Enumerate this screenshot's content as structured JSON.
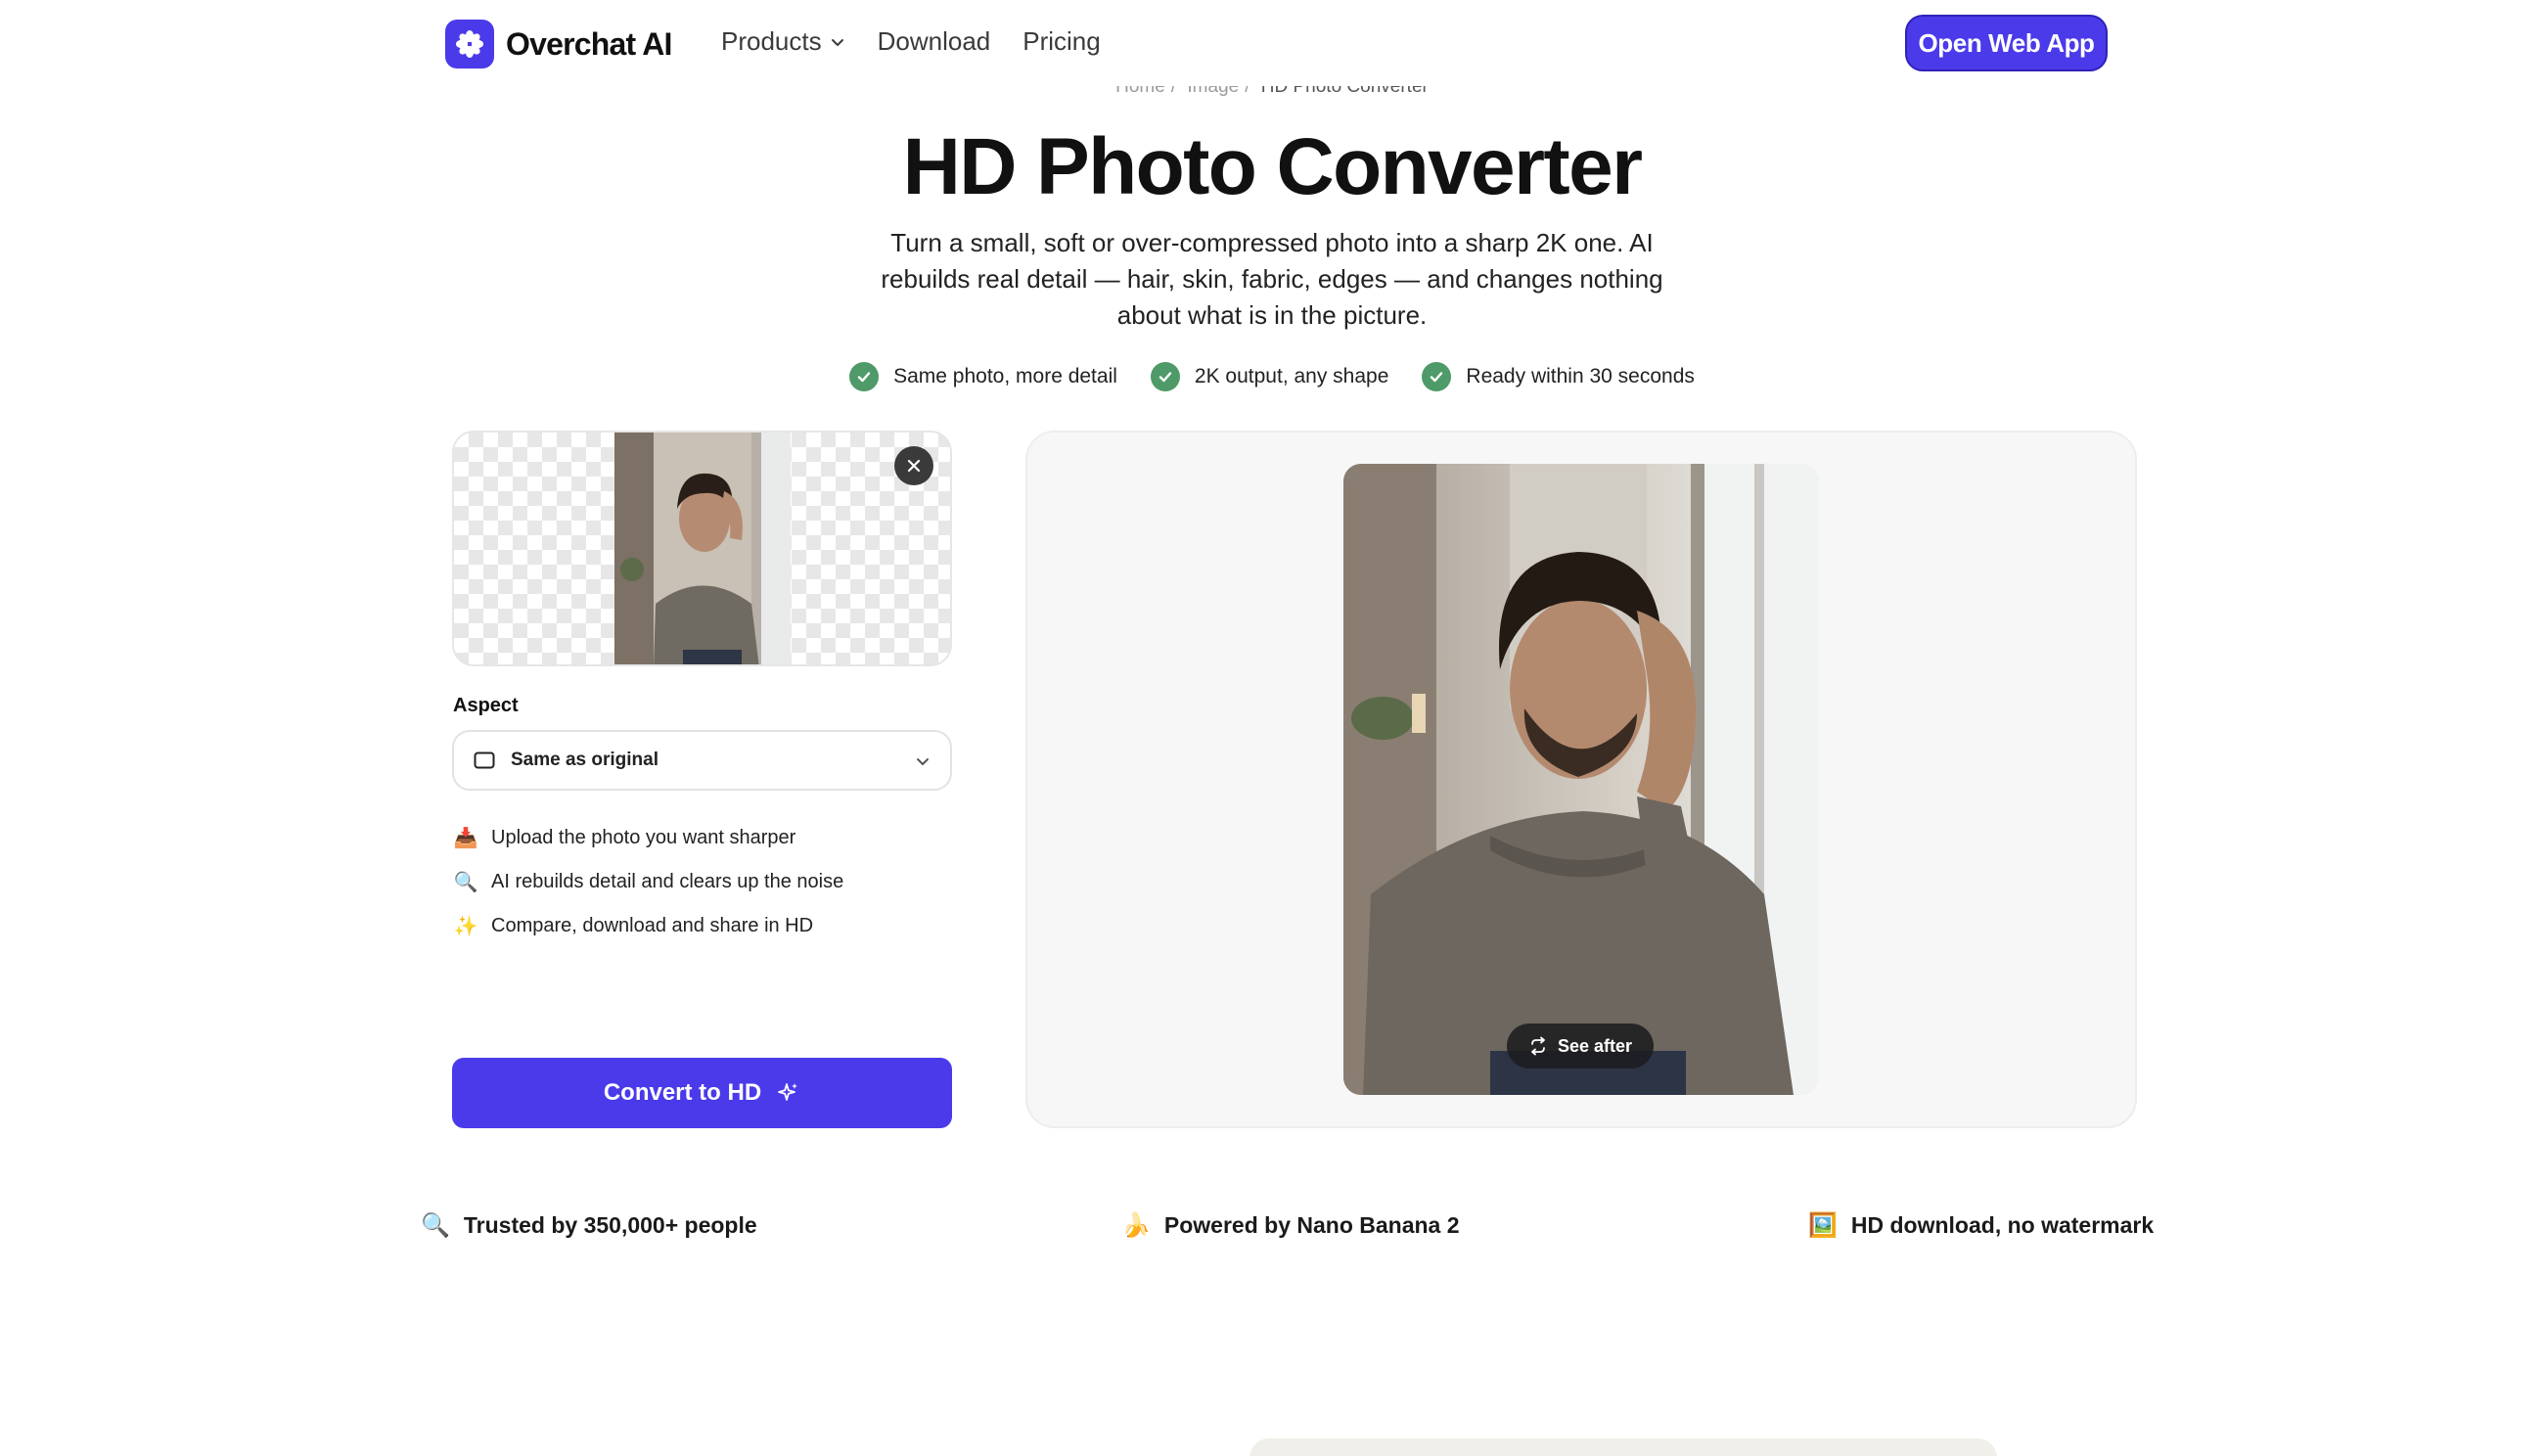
{
  "nav": {
    "brand": "Overchat AI",
    "links": [
      "Products",
      "Download",
      "Pricing"
    ],
    "cta": "Open Web App"
  },
  "breadcrumb": [
    "Home",
    "Image",
    "HD Photo Converter"
  ],
  "hero": {
    "title": "HD Photo Converter",
    "subtitle": "Turn a small, soft or over-compressed photo into a sharp 2K one. AI rebuilds real detail — hair, skin, fabric, edges — and changes nothing about what is in the picture.",
    "badges": [
      "Same photo, more detail",
      "2K output, any shape",
      "Ready within 30 seconds"
    ]
  },
  "tool": {
    "aspect_label": "Aspect",
    "aspect_value": "Same as original",
    "steps": [
      {
        "icon": "📥",
        "text": "Upload the photo you want sharper"
      },
      {
        "icon": "🔍",
        "text": "AI rebuilds detail and clears up the noise"
      },
      {
        "icon": "✨",
        "text": "Compare, download and share in HD"
      }
    ],
    "convert_label": "Convert to HD",
    "see_after_label": "See after"
  },
  "trust": [
    {
      "icon": "🔍",
      "text": "Trusted by 350,000+ people"
    },
    {
      "icon": "🍌",
      "text": "Powered by Nano Banana 2"
    },
    {
      "icon": "🖼️",
      "text": "HD download, no watermark"
    }
  ],
  "colors": {
    "accent": "#4a3aea",
    "check_green": "#4e9a68"
  }
}
